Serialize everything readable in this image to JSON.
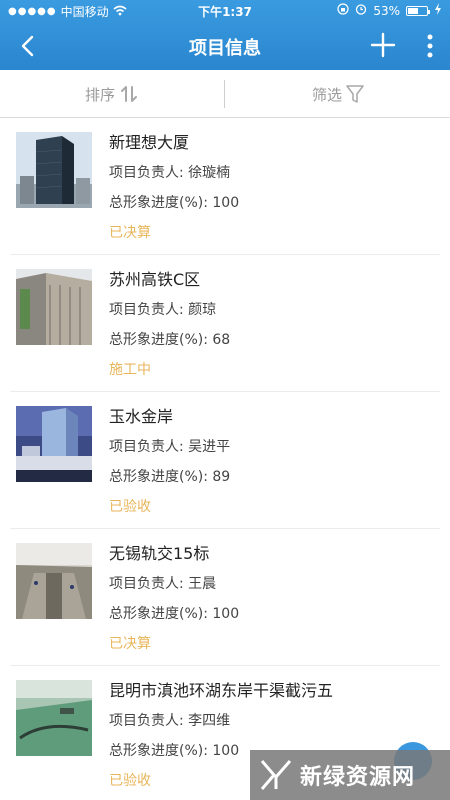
{
  "status_bar": {
    "carrier": "中国移动",
    "time": "下午1:37",
    "battery": "53%",
    "battery_level": 0.53
  },
  "nav": {
    "title": "项目信息"
  },
  "filters": {
    "sort_label": "排序",
    "filter_label": "筛选"
  },
  "projects": [
    {
      "name": "新理想大厦",
      "manager": "项目负责人: 徐璇楠",
      "progress": "总形象进度(%): 100",
      "status": "已决算"
    },
    {
      "name": "苏州高铁C区",
      "manager": "项目负责人: 颜琼",
      "progress": "总形象进度(%): 68",
      "status": "施工中"
    },
    {
      "name": "玉水金岸",
      "manager": "项目负责人: 吴进平",
      "progress": "总形象进度(%): 89",
      "status": "已验收"
    },
    {
      "name": "无锡轨交15标",
      "manager": "项目负责人: 王晨",
      "progress": "总形象进度(%): 100",
      "status": "已决算"
    },
    {
      "name": "昆明市滇池环湖东岸干渠截污五",
      "manager": "项目负责人: 李四维",
      "progress": "总形象进度(%): 100",
      "status": "已验收"
    }
  ],
  "watermark": {
    "text": "新绿资源网"
  },
  "colors": {
    "header": "#2a86cf",
    "status_text": "#e8b65a"
  }
}
